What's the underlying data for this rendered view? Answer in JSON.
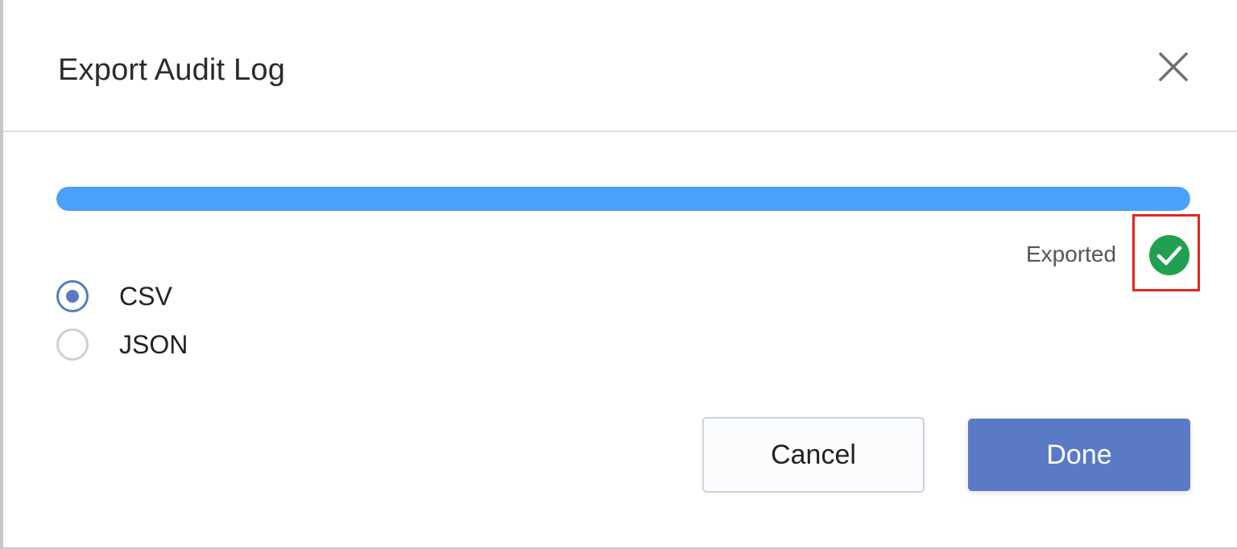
{
  "dialog": {
    "title": "Export Audit Log",
    "close_icon": "close-icon"
  },
  "progress": {
    "value_percent": 100,
    "fill_color": "#4ba0fa"
  },
  "status": {
    "text": "Exported",
    "icon": "check-circle-icon",
    "icon_color": "#22a052",
    "highlight_color": "#e4271b"
  },
  "format_options": [
    {
      "label": "CSV",
      "selected": true
    },
    {
      "label": "JSON",
      "selected": false
    }
  ],
  "buttons": {
    "cancel_label": "Cancel",
    "done_label": "Done"
  },
  "colors": {
    "accent": "#5a7ac5"
  }
}
